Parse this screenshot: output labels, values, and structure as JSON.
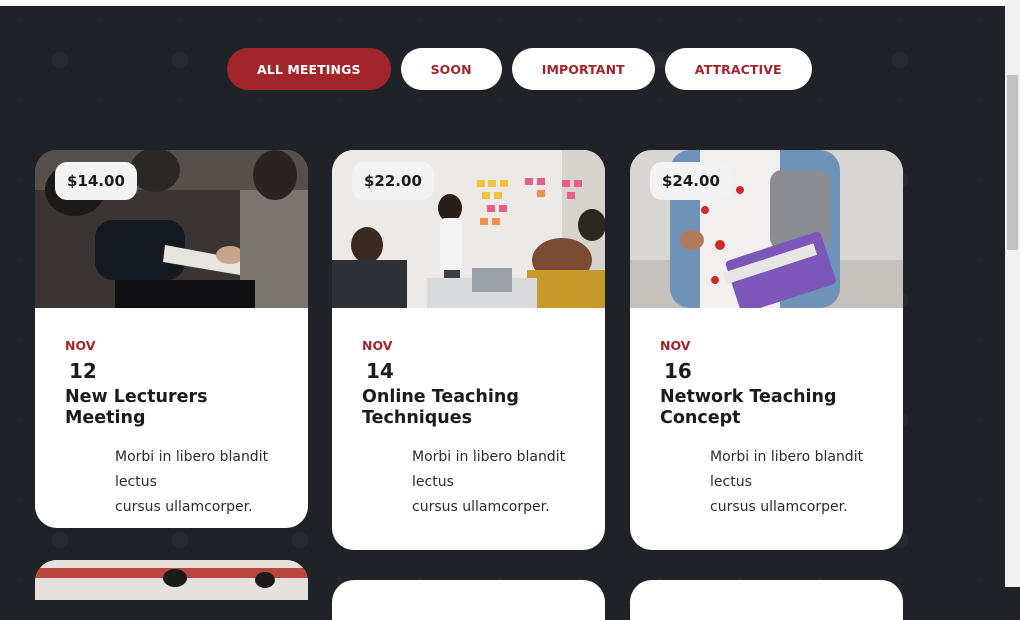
{
  "filters": [
    {
      "label": "ALL MEETINGS",
      "active": true
    },
    {
      "label": "SOON",
      "active": false
    },
    {
      "label": "IMPORTANT",
      "active": false
    },
    {
      "label": "ATTRACTIVE",
      "active": false
    }
  ],
  "cards": [
    {
      "price": "$14.00",
      "month": "NOV",
      "day": "12",
      "title": "New Lecturers Meeting",
      "desc_line1": "Morbi in libero blandit",
      "desc_line2": "lectus",
      "desc_line3": "cursus ullamcorper."
    },
    {
      "price": "$22.00",
      "month": "NOV",
      "day": "14",
      "title": "Online Teaching Techniques",
      "desc_line1": "Morbi in libero blandit",
      "desc_line2": "lectus",
      "desc_line3": "cursus ullamcorper."
    },
    {
      "price": "$24.00",
      "month": "NOV",
      "day": "16",
      "title": "Network Teaching Concept",
      "desc_line1": "Morbi in libero blandit",
      "desc_line2": "lectus",
      "desc_line3": "cursus ullamcorper."
    }
  ],
  "colors": {
    "accent": "#a1252b",
    "background": "#1f2327",
    "card": "#ffffff"
  }
}
